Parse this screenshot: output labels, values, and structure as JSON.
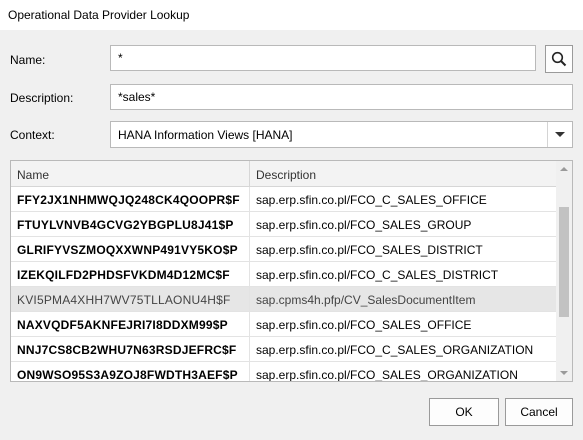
{
  "window": {
    "title": "Operational Data Provider Lookup"
  },
  "form": {
    "name_label": "Name:",
    "name_value": "*",
    "description_label": "Description:",
    "description_value": "*sales*",
    "context_label": "Context:",
    "context_value": "HANA Information Views [HANA]"
  },
  "table": {
    "columns": [
      "Name",
      "Description"
    ],
    "rows": [
      {
        "name": "FFY2JX1NHMWQJQ248CK4QOOPR$F",
        "description": "sap.erp.sfin.co.pl/FCO_C_SALES_OFFICE"
      },
      {
        "name": "FTUYLVNVB4GCVG2YBGPLU8J41$P",
        "description": "sap.erp.sfin.co.pl/FCO_SALES_GROUP"
      },
      {
        "name": "GLRIFYVSZMOQXXWNP491VY5KO$P",
        "description": "sap.erp.sfin.co.pl/FCO_SALES_DISTRICT"
      },
      {
        "name": "IZEKQILFD2PHDSFVKDM4D12MC$F",
        "description": "sap.erp.sfin.co.pl/FCO_C_SALES_DISTRICT"
      },
      {
        "name": "KVI5PMA4XHH7WV75TLLAONU4H$F",
        "description": "sap.cpms4h.pfp/CV_SalesDocumentItem"
      },
      {
        "name": "NAXVQDF5AKNFEJRI7I8DDXM99$P",
        "description": "sap.erp.sfin.co.pl/FCO_SALES_OFFICE"
      },
      {
        "name": "NNJ7CS8CB2WHU7N63RSDJEFRC$F",
        "description": "sap.erp.sfin.co.pl/FCO_C_SALES_ORGANIZATION"
      },
      {
        "name": "ON9WSO95S3A9ZOJ8FWDTH3AEF$P",
        "description": "sap.erp.sfin.co.pl/FCO_SALES_ORGANIZATION"
      }
    ]
  },
  "buttons": {
    "ok": "OK",
    "cancel": "Cancel"
  },
  "icons": {
    "search": "search-icon",
    "dropdown": "chevron-down-icon"
  }
}
